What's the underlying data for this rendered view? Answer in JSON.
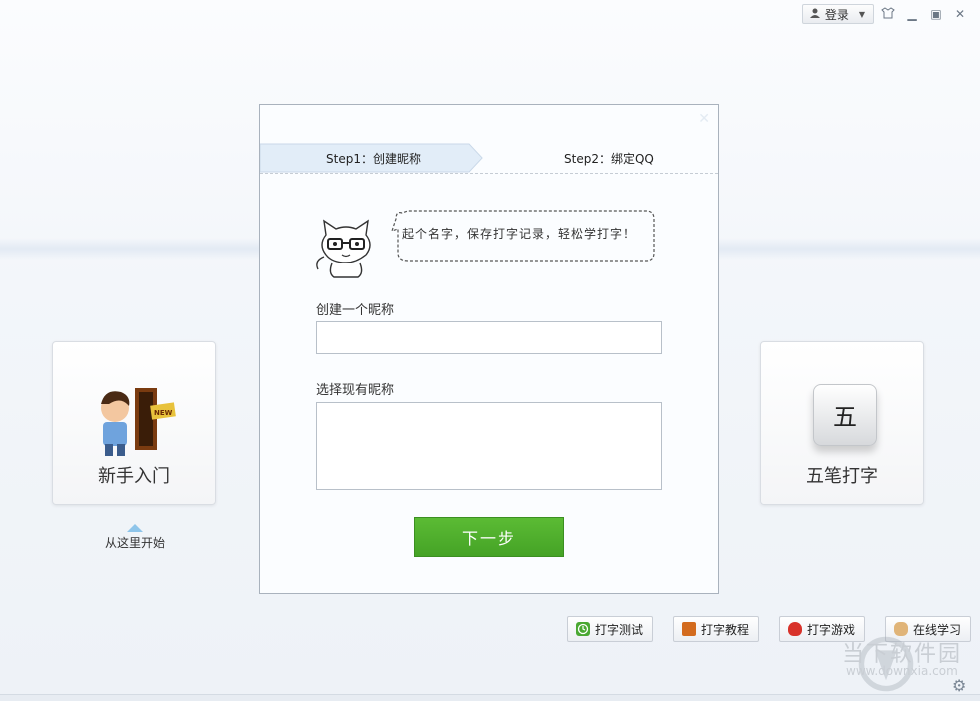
{
  "topbar": {
    "login_label": "登录",
    "icons": [
      "user-icon",
      "dropdown-icon",
      "skin-icon",
      "minimize-icon",
      "maximize-icon",
      "close-icon"
    ]
  },
  "left_card": {
    "label": "新手入门",
    "hint": "从这里开始",
    "badge": "NEW"
  },
  "right_card": {
    "label": "五笔打字",
    "key_char": "五"
  },
  "dialog": {
    "step1": "Step1：创建昵称",
    "step2": "Step2：绑定QQ",
    "bubble_text": "起个名字，保存打字记录，轻松学打字！",
    "create_label": "创建一个昵称",
    "create_value": "",
    "existing_label": "选择现有昵称",
    "existing_value": "",
    "next_label": "下一步"
  },
  "bottom_buttons": [
    {
      "label": "打字测试",
      "icon": "clock-icon",
      "color": "#4aa832"
    },
    {
      "label": "打字教程",
      "icon": "book-icon",
      "color": "#d36b1e"
    },
    {
      "label": "打字游戏",
      "icon": "balloon-icon",
      "color": "#d8322a"
    },
    {
      "label": "在线学习",
      "icon": "hand-icon",
      "color": "#e0b478"
    }
  ],
  "watermark": {
    "text": "当下软件园",
    "url": "www.downxia.com"
  },
  "colors": {
    "accent_green": "#4cae2c",
    "step_active": "#e3eef9"
  }
}
